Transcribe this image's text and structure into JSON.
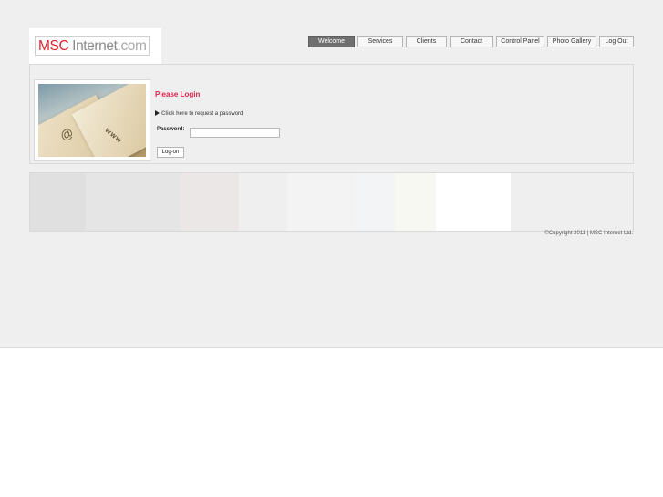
{
  "logo": {
    "brand_red": "MSC",
    "brand_mid": " Internet",
    "brand_end": ".com"
  },
  "nav": {
    "items": [
      {
        "label": "Welcome",
        "active": true
      },
      {
        "label": "Services",
        "active": false
      },
      {
        "label": "Clients",
        "active": false
      },
      {
        "label": "Contact",
        "active": false
      },
      {
        "label": "Control Panel",
        "active": false
      },
      {
        "label": "Photo Gallery",
        "active": false
      },
      {
        "label": "Log Out",
        "active": false
      }
    ]
  },
  "login": {
    "title": "Please Login",
    "click_here": "Click here",
    "request_text": " to request a password",
    "password_label": "Password:",
    "password_value": "",
    "logon_label": "Log-on",
    "photo_caption_www": "www",
    "photo_caption_at": "@"
  },
  "footer": {
    "copyright": "©Copyright 2011 | MSC Internet Ltd."
  },
  "colors": {
    "accent": "#d8254f",
    "logo_red": "#d8252e",
    "nav_active": "#707070",
    "page_background": "#efefef"
  }
}
